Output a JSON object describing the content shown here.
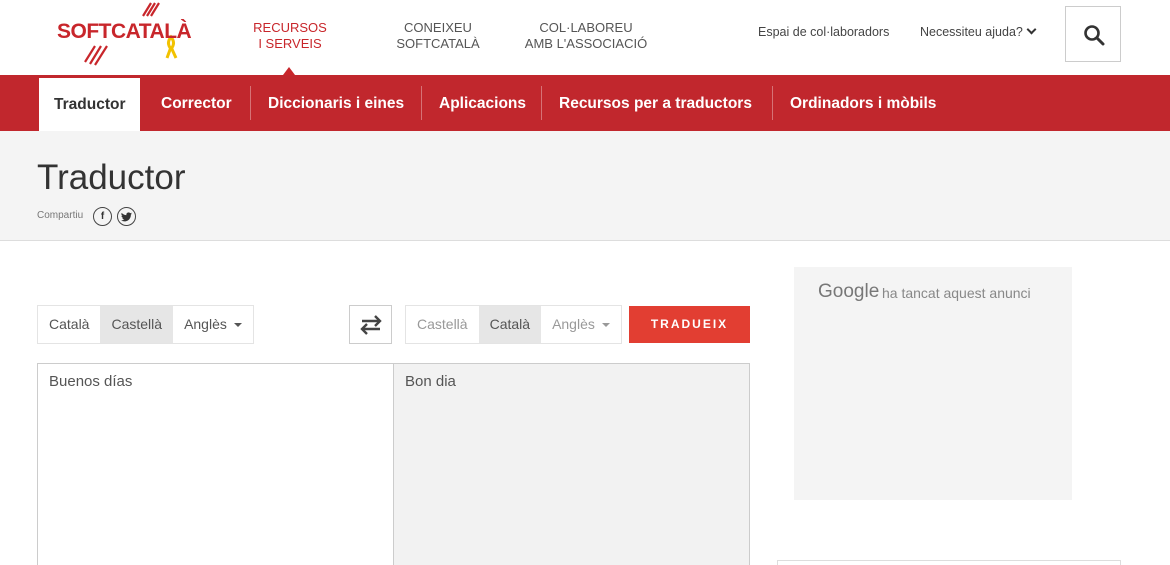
{
  "header": {
    "logo_text": "SOFTCATALÀ",
    "topnav": [
      {
        "line1": "RECURSOS",
        "line2": "I SERVEIS"
      },
      {
        "line1": "CONEIXEU",
        "line2": "SOFTCATALÀ"
      },
      {
        "line1": "COL·LABOREU",
        "line2": "AMB L'ASSOCIACIÓ"
      }
    ],
    "collaborators_link": "Espai de col·laboradors",
    "help_link": "Necessiteu ajuda?"
  },
  "subnav": {
    "items": [
      "Traductor",
      "Corrector",
      "Diccionaris i eines",
      "Aplicacions",
      "Recursos per a traductors",
      "Ordinadors i mòbils"
    ]
  },
  "page": {
    "title": "Traductor",
    "share_label": "Compartiu",
    "share_facebook": "f",
    "share_twitter": "t"
  },
  "translator": {
    "source_langs": [
      "Català",
      "Castellà",
      "Anglès"
    ],
    "source_selected": "Castellà",
    "target_langs": [
      "Castellà",
      "Català",
      "Anglès"
    ],
    "target_selected": "Català",
    "translate_button": "TRADUEIX",
    "source_text": "Buenos días",
    "target_text": "Bon dia"
  },
  "ad": {
    "brand": "Google",
    "message": "ha tancat aquest anunci"
  },
  "colors": {
    "brand_red": "#c1272d",
    "button_red": "#e23e32"
  }
}
